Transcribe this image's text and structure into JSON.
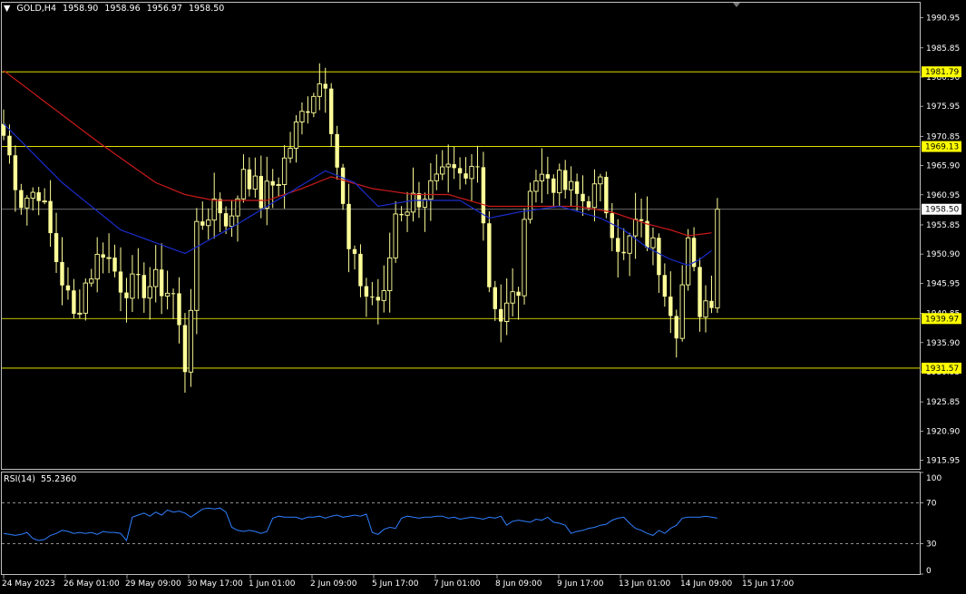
{
  "header": {
    "symbol": "GOLD,H4",
    "open": "1958.90",
    "high": "1958.96",
    "low": "1956.97",
    "close": "1958.50"
  },
  "rsi_header": {
    "label": "RSI(14)",
    "value": "55.2360"
  },
  "colors": {
    "background": "#000000",
    "frame": "#c0c0c0",
    "candle": "#ffff99",
    "level_line": "#ffff00",
    "ma_fast": "#1a2ccc",
    "ma_slow": "#cc1a1a",
    "rsi_line": "#2f7fff",
    "price_line": "#8c8c8c"
  },
  "chart_data": [
    {
      "type": "candlestick",
      "title": "GOLD,H4",
      "ylim": [
        1914.5,
        1993.5
      ],
      "y_ticks": [
        "1990.95",
        "1985.85",
        "1980.90",
        "1975.95",
        "1970.85",
        "1965.90",
        "1960.95",
        "1955.85",
        "1950.90",
        "1945.95",
        "1940.85",
        "1935.90",
        "1930.95",
        "1925.85",
        "1920.90",
        "1915.95"
      ],
      "x_labels": [
        "24 May 2023",
        "26 May 01:00",
        "29 May 09:00",
        "30 May 17:00",
        "1 Jun 01:00",
        "2 Jun 09:00",
        "5 Jun 17:00",
        "7 Jun 01:00",
        "8 Jun 09:00",
        "9 Jun 17:00",
        "13 Jun 01:00",
        "14 Jun 09:00",
        "15 Jun 17:00"
      ],
      "levels": [
        {
          "label": "1981.79",
          "value": 1981.79
        },
        {
          "label": "1969.13",
          "value": 1969.13
        },
        {
          "label": "1939.97",
          "value": 1939.97
        },
        {
          "label": "1931.57",
          "value": 1931.57
        }
      ],
      "current_price": {
        "label": "1958.50",
        "value": 1958.5
      },
      "anchors": [
        [
          0,
          1971
        ],
        [
          3,
          1960
        ],
        [
          6,
          1962
        ],
        [
          9,
          1950
        ],
        [
          12,
          1940
        ],
        [
          14,
          1946
        ],
        [
          17,
          1952
        ],
        [
          20,
          1946
        ],
        [
          23,
          1945
        ],
        [
          26,
          1946
        ],
        [
          29,
          1944
        ],
        [
          31,
          1932
        ],
        [
          33,
          1954
        ],
        [
          36,
          1960
        ],
        [
          39,
          1956
        ],
        [
          41,
          1966
        ],
        [
          44,
          1960
        ],
        [
          47,
          1964
        ],
        [
          50,
          1972
        ],
        [
          53,
          1979
        ],
        [
          55,
          1981
        ],
        [
          57,
          1966
        ],
        [
          59,
          1951
        ],
        [
          62,
          1944
        ],
        [
          65,
          1943
        ],
        [
          67,
          1958
        ],
        [
          70,
          1960
        ],
        [
          73,
          1962
        ],
        [
          76,
          1964
        ],
        [
          79,
          1963
        ],
        [
          81,
          1968
        ],
        [
          83,
          1946
        ],
        [
          85,
          1940
        ],
        [
          88,
          1945
        ],
        [
          90,
          1964
        ],
        [
          93,
          1964
        ],
        [
          96,
          1962
        ],
        [
          99,
          1960
        ],
        [
          102,
          1962
        ],
        [
          104,
          1956
        ],
        [
          106,
          1950
        ],
        [
          108,
          1956
        ],
        [
          111,
          1952
        ],
        [
          113,
          1946
        ],
        [
          115,
          1939
        ],
        [
          117,
          1952
        ],
        [
          119,
          1942
        ],
        [
          121,
          1944
        ],
        [
          123,
          1957
        ]
      ],
      "ma_fast": [
        [
          0,
          1973
        ],
        [
          10,
          1963
        ],
        [
          20,
          1955
        ],
        [
          31,
          1951
        ],
        [
          40,
          1956
        ],
        [
          50,
          1962
        ],
        [
          55,
          1965
        ],
        [
          60,
          1963
        ],
        [
          64,
          1959
        ],
        [
          70,
          1960
        ],
        [
          78,
          1960
        ],
        [
          83,
          1957
        ],
        [
          88,
          1958
        ],
        [
          95,
          1959
        ],
        [
          102,
          1957
        ],
        [
          106,
          1955
        ],
        [
          110,
          1952
        ],
        [
          114,
          1950
        ],
        [
          117,
          1949
        ],
        [
          119,
          1950
        ],
        [
          121,
          1951.5
        ]
      ],
      "ma_slow": [
        [
          0,
          1982
        ],
        [
          8,
          1976
        ],
        [
          16,
          1970
        ],
        [
          26,
          1963
        ],
        [
          31,
          1961
        ],
        [
          36,
          1960
        ],
        [
          45,
          1960
        ],
        [
          51,
          1962
        ],
        [
          56,
          1964
        ],
        [
          63,
          1962
        ],
        [
          70,
          1961
        ],
        [
          76,
          1961
        ],
        [
          83,
          1959
        ],
        [
          90,
          1959
        ],
        [
          98,
          1959
        ],
        [
          104,
          1958
        ],
        [
          110,
          1956
        ],
        [
          114,
          1955
        ],
        [
          117,
          1954
        ],
        [
          121,
          1954.5
        ]
      ]
    },
    {
      "type": "line",
      "title": "RSI(14) 55.2360",
      "ylim": [
        0,
        100
      ],
      "y_ticks": [
        "100",
        "70",
        "30",
        "0"
      ],
      "levels": [
        70,
        30
      ],
      "values": [
        40,
        39,
        38,
        39,
        41,
        35,
        33,
        34,
        38,
        40,
        43,
        42,
        40,
        41,
        40,
        41,
        39,
        42,
        41,
        41,
        40,
        33,
        56,
        58,
        60,
        57,
        61,
        58,
        63,
        61,
        62,
        60,
        56,
        60,
        64,
        65,
        64,
        65,
        61,
        46,
        43,
        42,
        43,
        42,
        40,
        42,
        55,
        57,
        56,
        56,
        56,
        54,
        56,
        56,
        57,
        55,
        57,
        58,
        56,
        57,
        58,
        57,
        59,
        41,
        39,
        44,
        46,
        45,
        55,
        57,
        56,
        55,
        56,
        56,
        57,
        57,
        55,
        56,
        54,
        55,
        56,
        55,
        54,
        56,
        55,
        57,
        48,
        52,
        53,
        52,
        51,
        54,
        53,
        56,
        51,
        50,
        48,
        40,
        42,
        43,
        45,
        46,
        48,
        49,
        53,
        55,
        56,
        50,
        45,
        43,
        40,
        38,
        43,
        40,
        45,
        48,
        55,
        56,
        56,
        56,
        57,
        56,
        55
      ]
    }
  ]
}
